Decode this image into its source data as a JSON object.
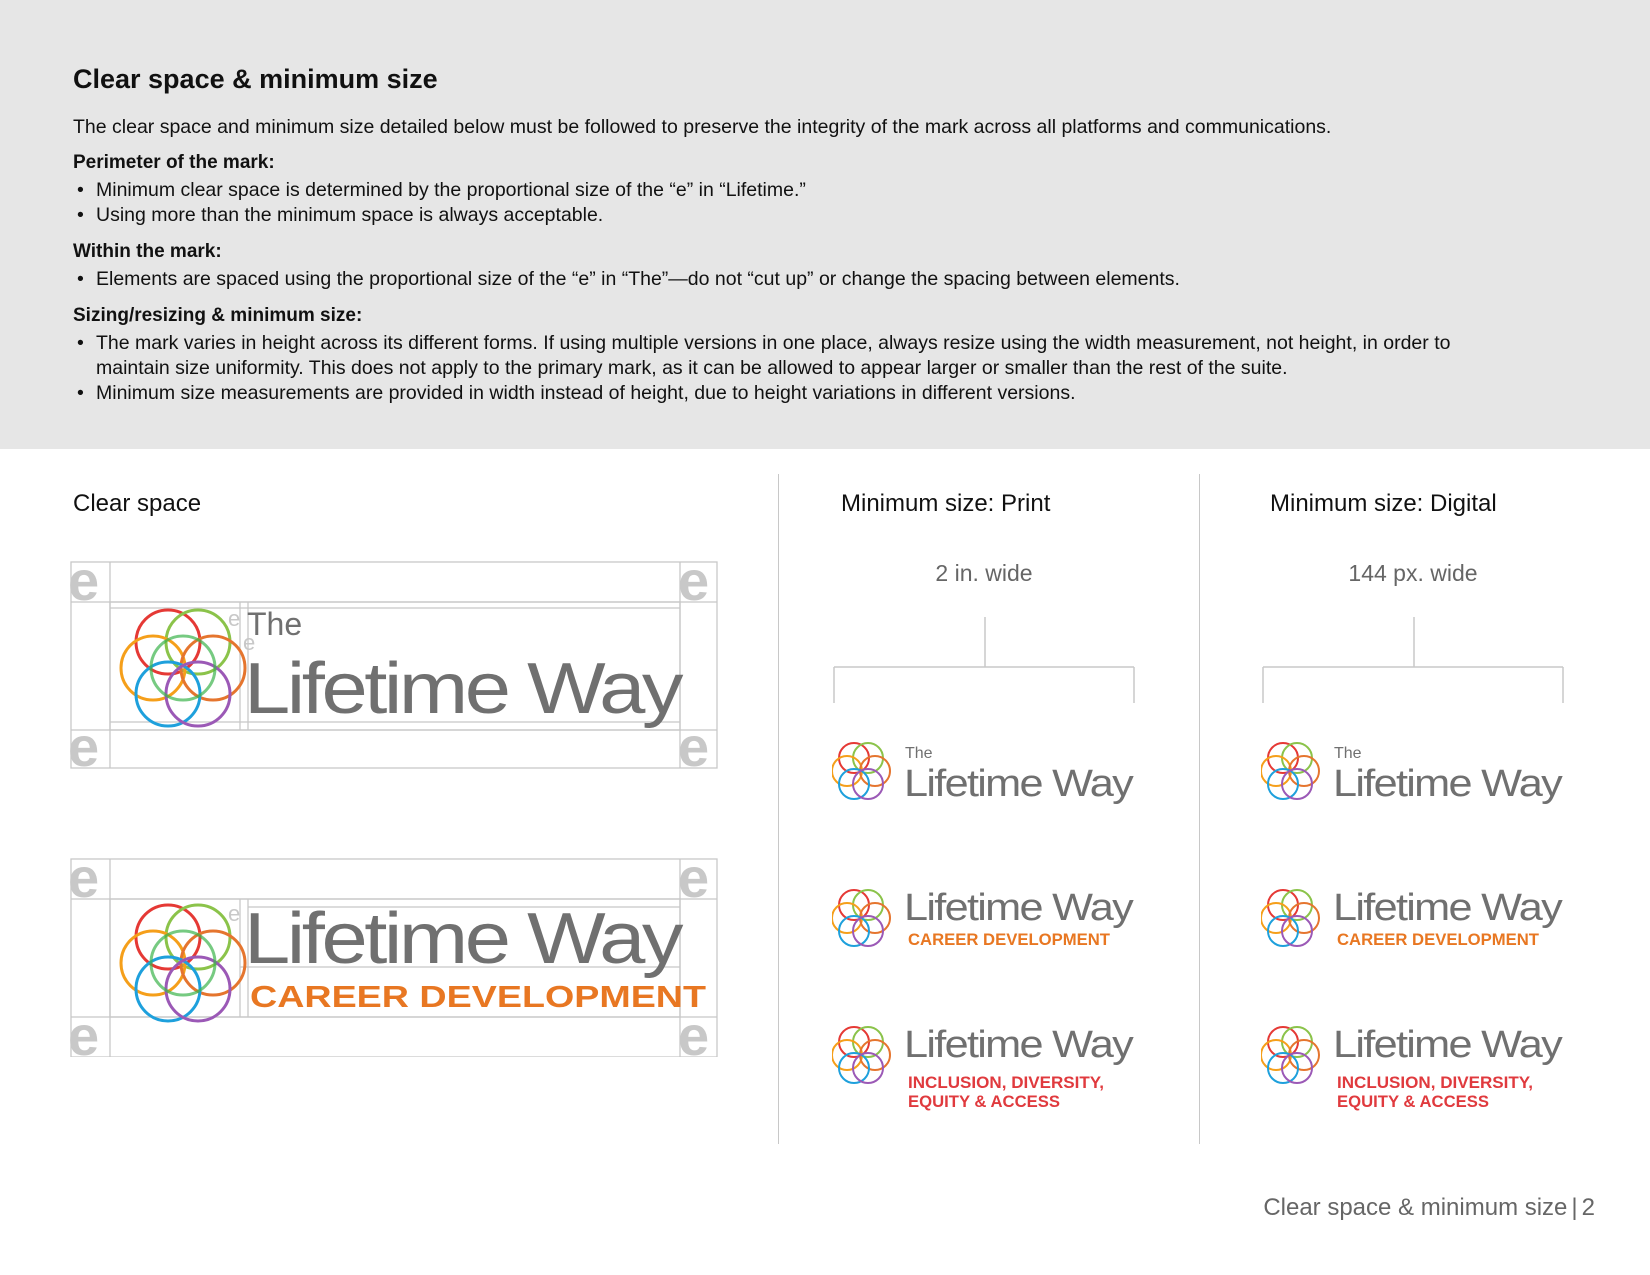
{
  "header": {
    "title": "Clear space & minimum size",
    "intro": "The clear space and minimum size detailed below must be followed to preserve the integrity of the mark across all platforms and communications."
  },
  "sections": [
    {
      "heading": "Perimeter of the mark:",
      "bullets": [
        "Minimum clear space is determined by the proportional size of the “e” in “Lifetime.”",
        "Using more than the minimum space is always acceptable."
      ]
    },
    {
      "heading": "Within the mark:",
      "bullets": [
        "Elements are spaced using the proportional size of the “e” in “The”—do not “cut up” or change the spacing between elements."
      ]
    },
    {
      "heading": "Sizing/resizing & minimum size:",
      "bullets": [
        "The mark varies in height across its different forms. If using multiple versions in one place, always resize using the width measurement, not height, in order to maintain size uniformity. This does not apply to the primary mark, as it can be allowed to appear larger or smaller than the rest of the suite.",
        "Minimum size measurements are provided in width instead of height, due to height variations in different versions."
      ]
    }
  ],
  "columns": {
    "clear_space": {
      "title": "Clear space"
    },
    "print": {
      "title": "Minimum size: Print",
      "width_label": "2 in. wide"
    },
    "digital": {
      "title": "Minimum size: Digital",
      "width_label": "144 px. wide"
    }
  },
  "logo": {
    "the": "The",
    "name": "Lifetime Way",
    "career": "CAREER DEVELOPMENT",
    "ide_line1": "INCLUSION, DIVERSITY,",
    "ide_line2": "EQUITY & ACCESS",
    "e_marker": "e"
  },
  "colors": {
    "gray_text": "#707070",
    "orange": "#e87722",
    "red": "#e03a3e",
    "guide": "#c8c8c8",
    "panel": "#e6e6e6",
    "rings": [
      "#e53935",
      "#8bc34a",
      "#f59f1a",
      "#1ea0dc",
      "#9b59b6",
      "#e5752e",
      "#3cb44b"
    ]
  },
  "footer": {
    "label": "Clear space & minimum size",
    "page": "2"
  }
}
